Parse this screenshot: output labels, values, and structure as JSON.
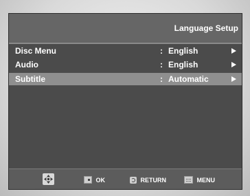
{
  "header": {
    "title": "Language Setup"
  },
  "menu": {
    "separator": ":",
    "items": [
      {
        "label": "Disc Menu",
        "value": "English",
        "selected": false
      },
      {
        "label": "Audio",
        "value": "English",
        "selected": false
      },
      {
        "label": "Subtitle",
        "value": "Automatic",
        "selected": true
      }
    ]
  },
  "footer": {
    "navigate_icon": "dpad-navigation-icon",
    "ok": {
      "icon": "ok-button-icon",
      "label": "OK"
    },
    "return": {
      "icon": "return-icon",
      "label": "RETURN"
    },
    "menu": {
      "icon": "menu-button-icon",
      "label": "MENU"
    }
  },
  "colors": {
    "panel": "#4b4b4b",
    "header": "#666666",
    "selected_row": "#8f8f8f",
    "text": "#ffffff"
  }
}
